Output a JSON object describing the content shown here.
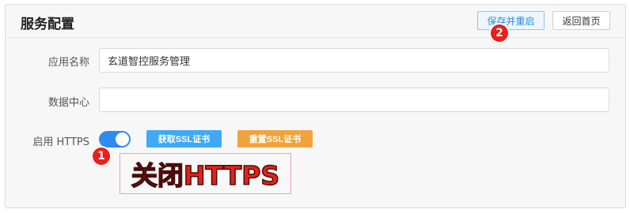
{
  "header": {
    "title": "服务配置",
    "save_restart_label": "保存并重启",
    "back_home_label": "返回首页"
  },
  "form": {
    "app_name_label": "应用名称",
    "app_name_value": "玄道智控服务管理",
    "data_center_label": "数据中心",
    "data_center_value": "",
    "https_label": "启用 HTTPS",
    "https_enabled": true,
    "get_ssl_label": "获取SSL证书",
    "reset_ssl_label": "重置SSL证书"
  },
  "annotations": {
    "badge_1": "1",
    "badge_2": "2",
    "callout_text": "关闭HTTPS"
  },
  "colors": {
    "primary": "#2d8cf0",
    "get_ssl_button": "#3fa9f5",
    "reset_ssl_button": "#f0a33c",
    "annotation_red": "#e8201a"
  }
}
